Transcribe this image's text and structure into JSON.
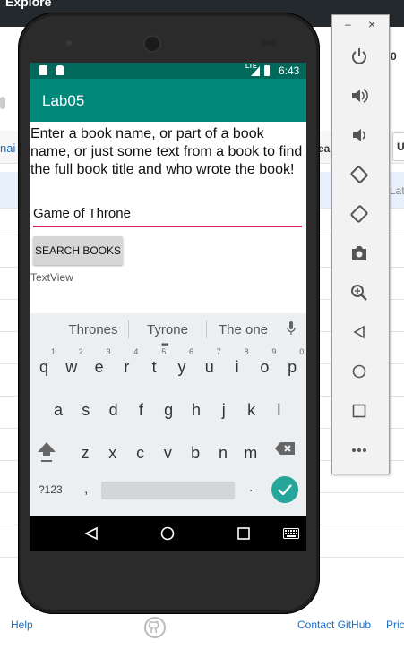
{
  "browser": {
    "title": "Explore",
    "cell_top_right": "0",
    "col_header_1": "ea",
    "col_header_2": "U",
    "left_text": "nai",
    "right_text": "Lat",
    "footer_help": "Help",
    "footer_contact": "Contact GitHub",
    "footer_pricing": "Pric"
  },
  "status_bar": {
    "time": "6:43",
    "network": "LTE"
  },
  "app": {
    "title": "Lab05",
    "prompt": "Enter a book name, or part of a book name, or just some text from a book to find the full book title and who wrote the book!",
    "input_value": "Game of Throne",
    "search_button": "SEARCH BOOKS",
    "result_text": "TextView"
  },
  "keyboard": {
    "suggestions": [
      "Thrones",
      "Tyrone",
      "The one"
    ],
    "row1": [
      "q",
      "w",
      "e",
      "r",
      "t",
      "y",
      "u",
      "i",
      "o",
      "p"
    ],
    "row1_hints": [
      "1",
      "2",
      "3",
      "4",
      "5",
      "6",
      "7",
      "8",
      "9",
      "0"
    ],
    "row2": [
      "a",
      "s",
      "d",
      "f",
      "g",
      "h",
      "j",
      "k",
      "l"
    ],
    "row3": [
      "z",
      "x",
      "c",
      "v",
      "b",
      "n",
      "m"
    ],
    "symbols_key": "?123",
    "comma_key": ",",
    "period_key": "."
  },
  "emulator_panel": {
    "minimize": "–",
    "close": "×",
    "icons": [
      "power-icon",
      "volume-up-icon",
      "volume-down-icon",
      "rotate-left-icon",
      "rotate-right-icon",
      "camera-icon",
      "zoom-icon",
      "back-icon",
      "home-icon",
      "overview-icon",
      "more-icon"
    ]
  },
  "colors": {
    "app_bar": "#00897b",
    "status_bar": "#00695c",
    "input_underline": "#d81b60",
    "enter_key": "#26a69a"
  }
}
